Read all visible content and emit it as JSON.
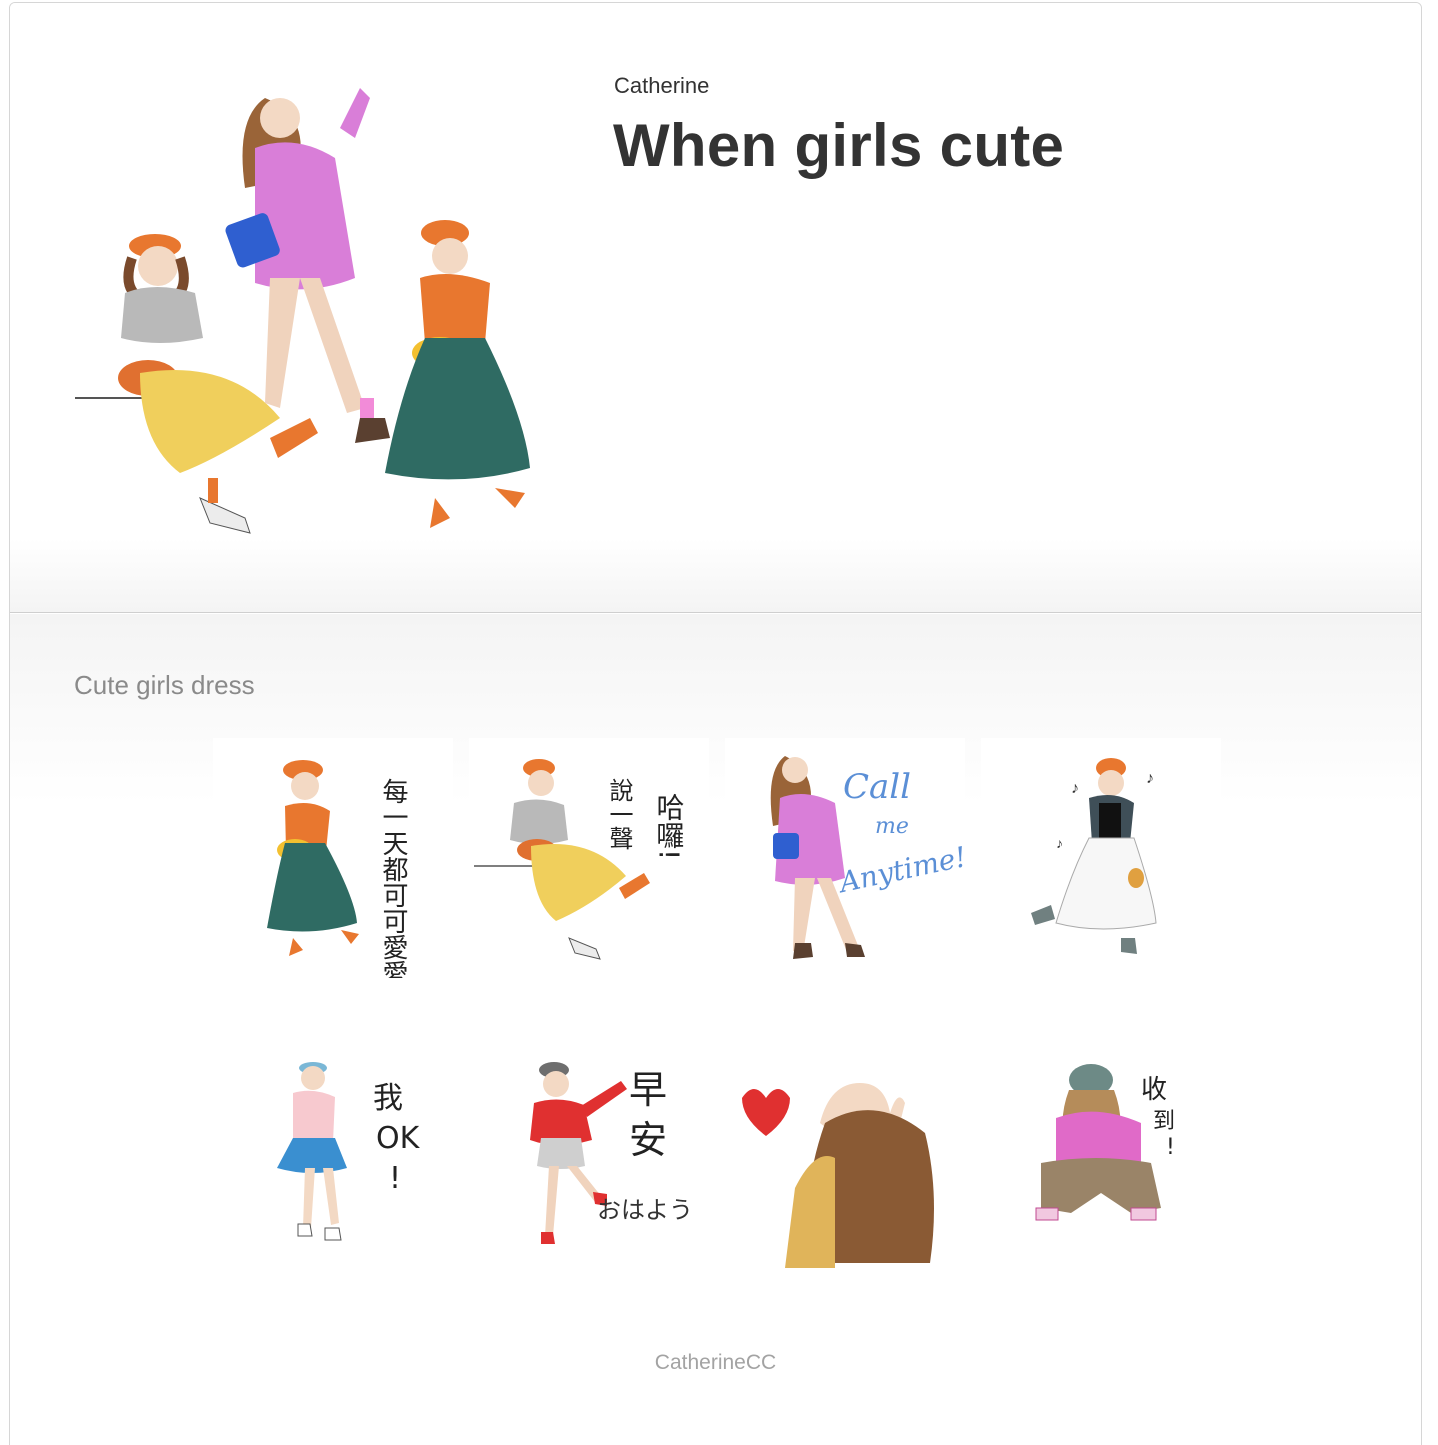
{
  "product": {
    "author": "Catherine",
    "title": "When girls cute",
    "description": "Cute girls dress",
    "copyright": "CatherineCC"
  },
  "stickers": [
    {
      "name": "girl-green-skirt",
      "caption": "每一天都可可愛愛"
    },
    {
      "name": "girl-sitting-yellow-skirt",
      "caption": "說一聲 哈囉!"
    },
    {
      "name": "girl-pink-jacket",
      "caption": "Call me Anytime!"
    },
    {
      "name": "girl-white-skirt-music",
      "caption": ""
    },
    {
      "name": "girl-blue-skirt",
      "caption": "我OK!"
    },
    {
      "name": "girl-red-jacket",
      "caption": "早安 おはよう"
    },
    {
      "name": "girl-heart-hands",
      "caption": ""
    },
    {
      "name": "girl-squatting-helmet",
      "caption": "收到!"
    }
  ]
}
